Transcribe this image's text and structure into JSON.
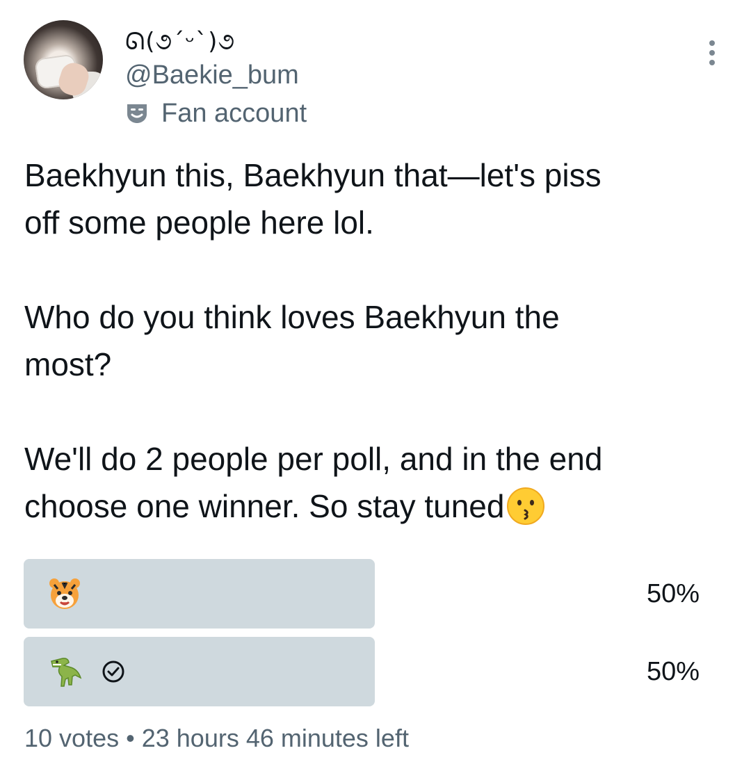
{
  "author": {
    "display_name": "ᘏ(૭ˊᵕˋ)૭",
    "handle": "@Baekie_bum",
    "label": "Fan account",
    "label_icon": "theater-mask-icon",
    "avatar": "profile-photo"
  },
  "tweet": {
    "text": "Baekhyun this, Baekhyun that—let's piss\noff some people here lol.\n\nWho do you think loves Baekhyun the\nmost?\n\nWe'll do 2 people per poll, and in the end\nchoose one winner. So stay tuned",
    "trailing_emoji": "kissing-face-emoji"
  },
  "poll": {
    "options": [
      {
        "emoji": "tiger-face-emoji",
        "percent_label": "50%",
        "share": 0.5,
        "voted": false
      },
      {
        "emoji": "t-rex-emoji",
        "percent_label": "50%",
        "share": 0.5,
        "voted": true
      }
    ],
    "votes_label": "10 votes",
    "separator": "•",
    "time_left": "23 hours 46 minutes left"
  },
  "colors": {
    "bar": "#cfd9de",
    "secondary_text": "#536471",
    "primary_text": "#0f1419"
  }
}
